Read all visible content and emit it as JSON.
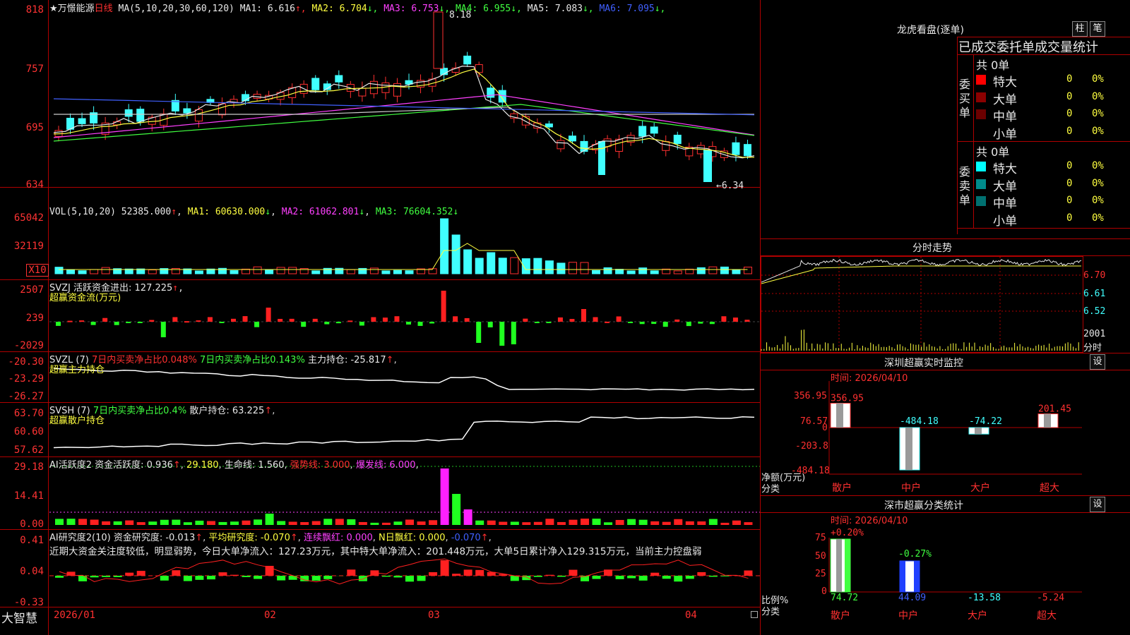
{
  "header": {
    "star_name": "★万憬能源",
    "period": "日线",
    "ma_label": "MA(5,10,20,30,60,120)",
    "ma": [
      {
        "label": "MA1:",
        "value": "6.616",
        "arrow": "↑",
        "color": "#e8e8e8"
      },
      {
        "label": "MA2:",
        "value": "6.704",
        "arrow": "↓",
        "color": "#ffff40"
      },
      {
        "label": "MA3:",
        "value": "6.753",
        "arrow": "↓",
        "color": "#ff40ff"
      },
      {
        "label": "MA4:",
        "value": "6.955",
        "arrow": "↓",
        "color": "#40ff40"
      },
      {
        "label": "MA5:",
        "value": "7.083",
        "arrow": "↓",
        "color": "#e8e8e8"
      },
      {
        "label": "MA6:",
        "value": "7.095",
        "arrow": "↓",
        "color": "#4060ff"
      }
    ],
    "high_marker": "8.18",
    "low_marker": "6.34",
    "price_axis": [
      "818",
      "757",
      "695",
      "634"
    ]
  },
  "vol": {
    "title": "VOL(5,10,20)",
    "value": "52385.000",
    "ma1": "MA1: 60630.000",
    "ma2": "MA2: 61062.801",
    "ma3": "MA3: 76604.352",
    "axis": [
      "65042",
      "32119",
      "X10"
    ]
  },
  "svzj": {
    "title": "SVZJ  活跃资金进出: 127.225",
    "subtitle": "超赢资金流(万元)",
    "axis": [
      "2507",
      "239",
      "-2029"
    ]
  },
  "svzl": {
    "title_a": "SVZL (7)",
    "title_b": "7日内买卖净占比0.048%",
    "title_c": "7日内买卖净占比0.143%",
    "title_d": "主力持仓: -25.817",
    "subtitle": "超赢主力持仓",
    "axis": [
      "-20.30",
      "-23.29",
      "-26.27"
    ]
  },
  "svsh": {
    "title_a": "SVSH (7)",
    "title_b": "7日内买卖净占比0.4%",
    "title_c": "散户持仓: 63.225",
    "subtitle": "超赢散户持仓",
    "axis": [
      "63.70",
      "60.60",
      "57.62"
    ]
  },
  "ai_active": {
    "title_a": "AI活跃度2",
    "title_b": "资金活跃度: 0.936",
    "title_c": "29.180",
    "title_d": "生命线: 1.560",
    "title_e": "强势线: 3.000",
    "title_f": "爆发线: 6.000",
    "axis": [
      "29.18",
      "14.41",
      "0.00"
    ]
  },
  "ai_research": {
    "title_a": "AI研究度2(10)",
    "title_b": "资金研究度: -0.013",
    "title_c": "平均研究度: -0.070",
    "title_d": "连续飘红: 0.000",
    "title_e": "N日飘红: 0.000",
    "title_f": "-0.070",
    "comment": "近期大资金关注度较低，明显弱势，今日大单净流入：127.23万元，其中特大单净流入：201.448万元，大单5日累计净入129.315万元，当前主力控盘弱",
    "axis": [
      "0.41",
      "0.04",
      "-0.33"
    ]
  },
  "footer": {
    "brand": "大智慧",
    "dates": [
      "2026/01",
      "02",
      "03",
      "04"
    ]
  },
  "dragon": {
    "title": "龙虎看盘(逐单)",
    "btn_zhu": "柱",
    "btn_bi": "笔",
    "subtitle": "已成交委托单成交量统计",
    "buy_label": "委买单",
    "sell_label": "委卖单",
    "buy_total": "共 0单",
    "sell_total": "共 0单",
    "buy_rows": [
      {
        "name": "特大",
        "val": "0",
        "pct": "0%",
        "color": "#ff0000"
      },
      {
        "name": "大单",
        "val": "0",
        "pct": "0%",
        "color": "#8b0000"
      },
      {
        "name": "中单",
        "val": "0",
        "pct": "0%",
        "color": "#6b0000"
      },
      {
        "name": "小单",
        "val": "0",
        "pct": "0%",
        "color": "#000000"
      }
    ],
    "sell_rows": [
      {
        "name": "特大",
        "val": "0",
        "pct": "0%",
        "color": "#00ffff"
      },
      {
        "name": "大单",
        "val": "0",
        "pct": "0%",
        "color": "#008b8b"
      },
      {
        "name": "中单",
        "val": "0",
        "pct": "0%",
        "color": "#007070"
      },
      {
        "name": "小单",
        "val": "0",
        "pct": "0%",
        "color": "#000000"
      }
    ]
  },
  "intraday": {
    "title": "分时走势",
    "axis": [
      "6.70",
      "6.61",
      "6.52",
      "2001",
      "分时"
    ]
  },
  "sz_monitor": {
    "title": "深圳超赢实时监控",
    "btn": "设",
    "time": "时间: 2026/04/10",
    "axis": [
      "356.95",
      "76.57",
      "0",
      "-203.8",
      "-484.18"
    ],
    "ylabel": "净额(万元)",
    "xlabel": "分类",
    "bars": [
      {
        "cat": "散户",
        "value": 356.95,
        "label": "356.95"
      },
      {
        "cat": "中户",
        "value": -484.18,
        "label": "-484.18"
      },
      {
        "cat": "大户",
        "value": -74.22,
        "label": "-74.22"
      },
      {
        "cat": "超大",
        "value": 201.45,
        "label": "201.45"
      }
    ]
  },
  "sz_class": {
    "title": "深市超赢分类统计",
    "btn": "设",
    "time": "时间: 2026/04/10",
    "axis": [
      "75",
      "50",
      "25",
      "0"
    ],
    "ylabel": "比例%",
    "xlabel": "分类",
    "top_labels": [
      "+0.20%",
      "-0.27%"
    ],
    "bottom_values": [
      "74.72",
      "44.09",
      "-13.58",
      "-5.24"
    ],
    "cats": [
      "散户",
      "中户",
      "大户",
      "超大"
    ]
  }
}
